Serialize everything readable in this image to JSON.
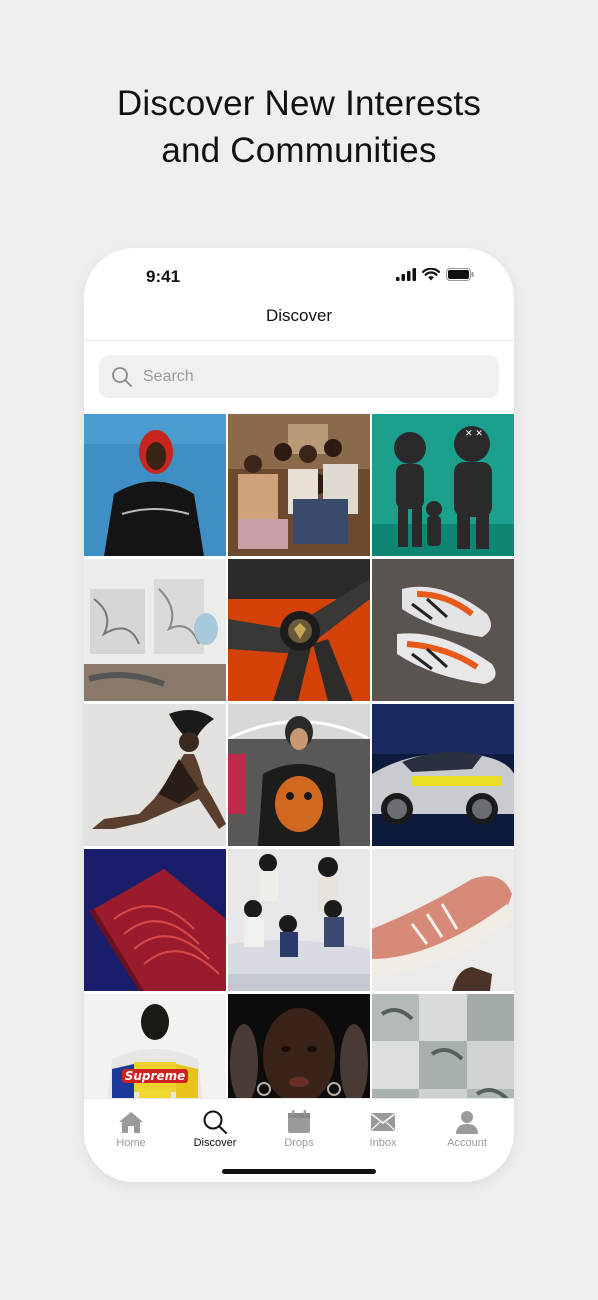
{
  "headline": {
    "line1": "Discover New Interests",
    "line2": "and Communities"
  },
  "status": {
    "time": "9:41"
  },
  "nav": {
    "title": "Discover"
  },
  "search": {
    "placeholder": "Search"
  },
  "grid": {
    "tiles": [
      {
        "name": "tile-hooded-man-blue"
      },
      {
        "name": "tile-group-friends"
      },
      {
        "name": "tile-kaws-figures"
      },
      {
        "name": "tile-art-gallery"
      },
      {
        "name": "tile-lamborghini-wheel"
      },
      {
        "name": "tile-sneaker-orange"
      },
      {
        "name": "tile-fashion-pose"
      },
      {
        "name": "tile-subway-portrait"
      },
      {
        "name": "tile-concept-car"
      },
      {
        "name": "tile-red-book"
      },
      {
        "name": "tile-women-car"
      },
      {
        "name": "tile-pink-sneaker"
      },
      {
        "name": "tile-supreme-jacket"
      },
      {
        "name": "tile-portrait-woman"
      },
      {
        "name": "tile-grey-collage"
      }
    ]
  },
  "tabs": [
    {
      "label": "Home",
      "icon": "home-icon",
      "active": false
    },
    {
      "label": "Discover",
      "icon": "search-icon",
      "active": true
    },
    {
      "label": "Drops",
      "icon": "calendar-icon",
      "active": false
    },
    {
      "label": "Inbox",
      "icon": "mail-icon",
      "active": false
    },
    {
      "label": "Account",
      "icon": "person-icon",
      "active": false
    }
  ],
  "colors": {
    "accent": "#111111",
    "inactive": "#9a9a9a",
    "background": "#efefef"
  }
}
